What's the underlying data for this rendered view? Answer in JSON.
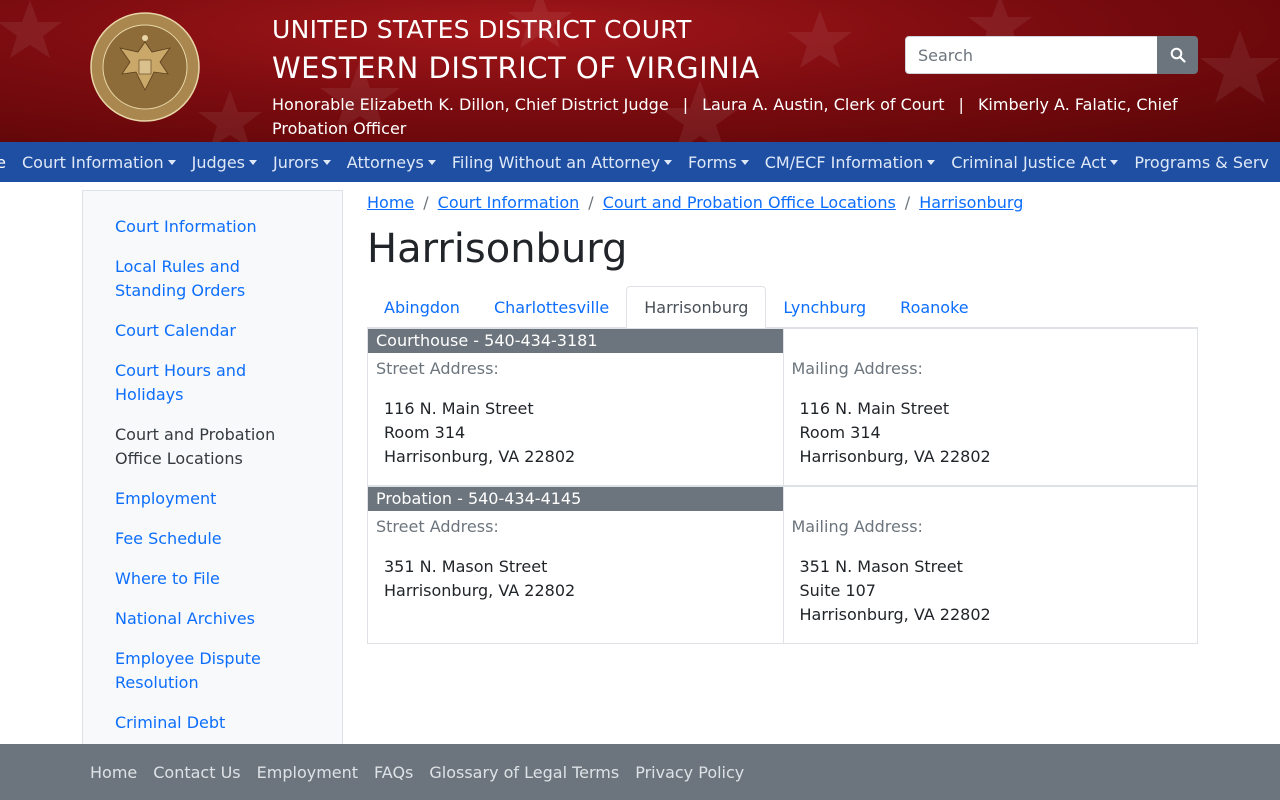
{
  "header": {
    "line1": "UNITED STATES DISTRICT COURT",
    "line2": "WESTERN DISTRICT OF VIRGINIA",
    "officials": [
      "Honorable Elizabeth K. Dillon, Chief District Judge",
      "Laura A. Austin, Clerk of Court",
      "Kimberly A. Falatic, Chief Probation Officer"
    ],
    "separator": "|",
    "seal_icon": "court-seal-icon",
    "colors": {
      "banner": "#7d0c10",
      "nav": "#1e4fa3",
      "footer": "#6c757d",
      "link": "#0d6efd"
    }
  },
  "search": {
    "placeholder": "Search",
    "value": "",
    "button_icon": "search-icon"
  },
  "nav": {
    "home_partial": "ne",
    "items": [
      "Court Information",
      "Judges",
      "Jurors",
      "Attorneys",
      "Filing Without an Attorney",
      "Forms",
      "CM/ECF Information",
      "Criminal Justice Act",
      "Programs & Serv"
    ]
  },
  "sidebar": {
    "items": [
      "Court Information",
      "Local Rules and Standing Orders",
      "Court Calendar",
      "Court Hours and Holidays",
      "Court and Probation Office Locations",
      "Employment",
      "Fee Schedule",
      "Where to File",
      "National Archives",
      "Employee Dispute Resolution",
      "Criminal Debt"
    ],
    "active_index": 4
  },
  "breadcrumb": [
    "Home",
    "Court Information",
    "Court and Probation Office Locations",
    "Harrisonburg"
  ],
  "page_title": "Harrisonburg",
  "tabs": [
    "Abingdon",
    "Charlottesville",
    "Harrisonburg",
    "Lynchburg",
    "Roanoke"
  ],
  "active_tab": 2,
  "offices": [
    {
      "heading": "Courthouse - 540-434-3181",
      "street_label": "Street Address:",
      "street": [
        "116 N. Main Street",
        "Room 314",
        "Harrisonburg, VA 22802"
      ],
      "mailing_label": "Mailing Address:",
      "mailing": [
        "116 N. Main Street",
        "Room 314",
        "Harrisonburg, VA 22802"
      ]
    },
    {
      "heading": "Probation - 540-434-4145",
      "street_label": "Street Address:",
      "street": [
        "351 N. Mason Street",
        "Harrisonburg, VA 22802"
      ],
      "mailing_label": "Mailing Address:",
      "mailing": [
        "351 N. Mason Street",
        "Suite 107",
        "Harrisonburg, VA 22802"
      ]
    }
  ],
  "footer": [
    "Home",
    "Contact Us",
    "Employment",
    "FAQs",
    "Glossary of Legal Terms",
    "Privacy Policy"
  ]
}
